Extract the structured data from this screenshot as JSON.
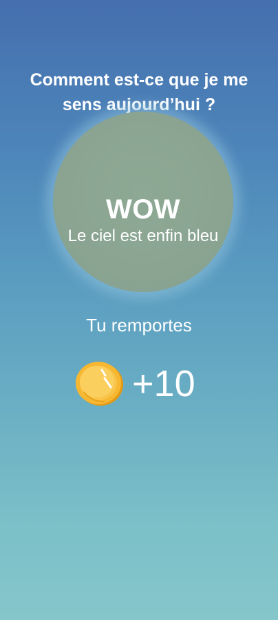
{
  "screen": {
    "question": "Comment est-ce que je me sens aujourd’hui ?"
  },
  "mood": {
    "title": "WOW",
    "subtitle": "Le ciel est enfin bleu",
    "circle_color": "#8aa491"
  },
  "reward": {
    "label": "Tu remportes",
    "amount": "+10",
    "icon": "coin-icon",
    "coin_color": "#f7b731"
  },
  "colors": {
    "background_top": "#456fae",
    "background_bottom": "#84c6ca",
    "text": "#ffffff"
  }
}
